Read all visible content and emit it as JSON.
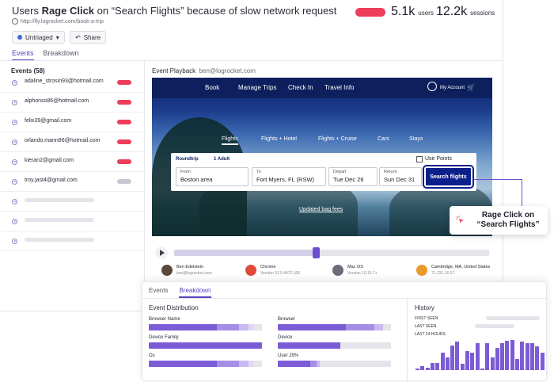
{
  "header": {
    "title_prefix": "Users ",
    "title_bold": "Rage Click",
    "title_suffix": " on  “Search Flights” because of slow network request",
    "url": "http://fly.logrocket.com/book-a-trip",
    "users_count": "5.1k",
    "users_label": "users",
    "sessions_count": "12.2k",
    "sessions_label": "sessions",
    "status_label": "Untriaged",
    "share_label": "Share",
    "tabs": [
      "Events",
      "Breakdown"
    ]
  },
  "events": {
    "heading": "Events (58)",
    "rows": [
      {
        "email": "adaline_strosin93@hotmail.com",
        "status": "red"
      },
      {
        "email": "alphonso86@hotmail.com",
        "status": "red"
      },
      {
        "email": "felix39@gmail.com",
        "status": "red"
      },
      {
        "email": "orlando.mann86@hotmail.com",
        "status": "red"
      },
      {
        "email": "kieran2@gmail.com",
        "status": "red"
      },
      {
        "email": "troy.jast4@gmail.com",
        "status": "grey"
      }
    ]
  },
  "playback": {
    "title": "Event Playback",
    "user": "ben@logrocket.com",
    "nav": [
      "Book",
      "Manage Trips",
      "Check In",
      "Travel Info",
      "My Account"
    ],
    "subnav": [
      "Flights",
      "Flights + Hotel",
      "Flights + Cruise",
      "Cars",
      "Stays"
    ],
    "trip_type": "Roundtrip",
    "adults": "1 Adult",
    "use_points": "Use Points",
    "fields": [
      {
        "label": "From",
        "value": "Boston area"
      },
      {
        "label": "To",
        "value": "Fort Myers, FL (RSW)"
      },
      {
        "label": "Depart",
        "value": "Tue Dec 26"
      },
      {
        "label": "Return",
        "value": "Sun Dec 31"
      }
    ],
    "search_button": "Search flights",
    "bag_fees": "Updated bag fees",
    "progress": 0.45,
    "meta": [
      {
        "a": "Ben Edelstein",
        "b": "ben@logrocket.com",
        "icon": "avatar",
        "color": "#5b4a3a"
      },
      {
        "a": "Chrome",
        "b": "Version 91.0.4472.106",
        "icon": "chrome-icon",
        "color": "#e04a3a"
      },
      {
        "a": "Mac OS",
        "b": "Version 10.15.7+",
        "icon": "apple-icon",
        "color": "#6c6c7a"
      },
      {
        "a": "Cambridge, MA, United States",
        "b": "71.231.16.57",
        "icon": "location-pin-icon",
        "color": "#e89a2a"
      }
    ]
  },
  "callout": {
    "line1": "Rage Click on",
    "line2": "“Search Flights”"
  },
  "breakdown": {
    "tabs": [
      "Events",
      "Breakdown"
    ],
    "title": "Event Distribution",
    "items": [
      {
        "label": "Browser Name",
        "segments": [
          0.6,
          0.2,
          0.08,
          0.04
        ]
      },
      {
        "label": "Browser",
        "segments": [
          0.6,
          0.25,
          0.08
        ]
      },
      {
        "label": "Device Family",
        "segments": [
          1.0
        ]
      },
      {
        "label": "Device",
        "segments": [
          0.55
        ]
      },
      {
        "label": "Os",
        "segments": [
          0.6,
          0.2,
          0.08,
          0.04
        ]
      },
      {
        "label": "User 29%",
        "segments": [
          0.29,
          0.05,
          0.03
        ]
      }
    ],
    "history": {
      "title": "History",
      "labels": [
        "FIRST SEEN",
        "LAST SEEN",
        "LAST 24 HOURS"
      ],
      "bars": [
        0.05,
        0.12,
        0.08,
        0.22,
        0.22,
        0.55,
        0.4,
        0.78,
        0.9,
        0.2,
        0.6,
        0.55,
        0.85,
        0.05,
        0.85,
        0.4,
        0.7,
        0.85,
        0.92,
        0.95,
        0.35,
        0.9,
        0.85,
        0.85,
        0.75,
        0.55
      ]
    }
  },
  "colors": {
    "accent": "#6c4dd1",
    "red": "#ee3d5b",
    "grey": "#c8c8d2"
  }
}
